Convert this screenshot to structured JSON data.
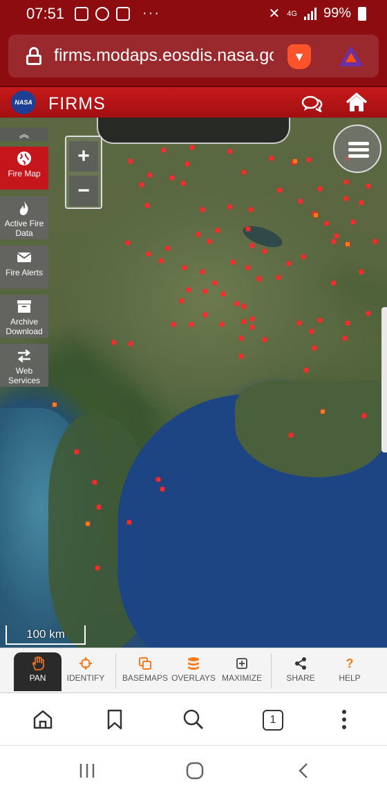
{
  "status_bar": {
    "time": "07:51",
    "network": "4G",
    "battery": "99%"
  },
  "browser": {
    "url": "firms.modaps.eosdis.nasa.gov"
  },
  "header": {
    "logo": "NASA",
    "title": "FIRMS"
  },
  "sidebar": {
    "items": [
      {
        "label": "Fire Map",
        "icon": "globe-icon"
      },
      {
        "label": "Active Fire Data",
        "icon": "flame-icon"
      },
      {
        "label": "Fire Alerts",
        "icon": "envelope-icon"
      },
      {
        "label": "Archive Download",
        "icon": "archive-box-icon"
      },
      {
        "label": "Web Services",
        "icon": "transfer-arrows-icon"
      }
    ]
  },
  "map": {
    "zoom_in": "+",
    "zoom_out": "−",
    "scale": "100 km"
  },
  "toolbar": {
    "items": [
      {
        "label": "PAN",
        "icon": "hand-icon"
      },
      {
        "label": "IDENTIFY",
        "icon": "crosshair-icon"
      },
      {
        "label": "BASEMAPS",
        "icon": "layers-copy-icon"
      },
      {
        "label": "OVERLAYS",
        "icon": "database-stack-icon"
      },
      {
        "label": "MAXIMIZE",
        "icon": "plus-square-icon"
      },
      {
        "label": "SHARE",
        "icon": "share-icon"
      },
      {
        "label": "HELP",
        "icon": "question-icon"
      }
    ]
  },
  "browser_nav": {
    "tab_count": "1"
  },
  "colors": {
    "brand_red": "#c5161c",
    "header_dark_red": "#8c0c10",
    "fire_dot": "#ff2a2a",
    "accent_orange": "#ff7a1a"
  }
}
